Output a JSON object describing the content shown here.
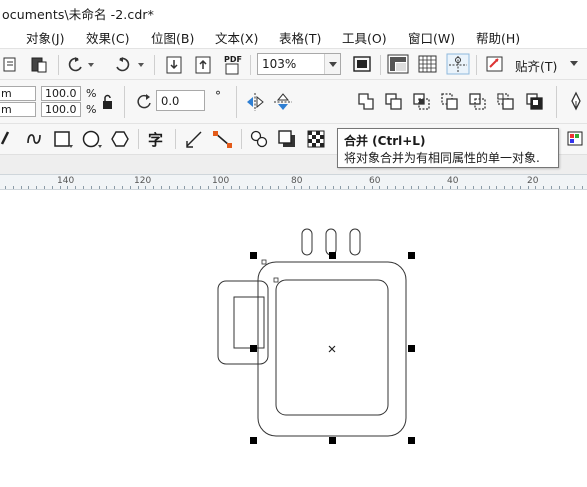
{
  "window": {
    "title": "ocuments\\未命名 -2.cdr*"
  },
  "menu": [
    {
      "label": "对象(J)"
    },
    {
      "label": "效果(C)"
    },
    {
      "label": "位图(B)"
    },
    {
      "label": "文本(X)"
    },
    {
      "label": "表格(T)"
    },
    {
      "label": "工具(O)"
    },
    {
      "label": "窗口(W)"
    },
    {
      "label": "帮助(H)"
    }
  ],
  "toolbar": {
    "zoom_value": "103%",
    "pdf_label": "PDF",
    "snap_label": "贴齐(T)"
  },
  "properties": {
    "size_w_unit": "m",
    "size_h_unit": "m",
    "scale_x": "100.0",
    "scale_y": "100.0",
    "percent_x": "%",
    "percent_y": "%",
    "rotation": "0.0",
    "rotation_unit": "°"
  },
  "tools": {
    "text_tool_glyph": "字"
  },
  "tooltip": {
    "title": "合并 (Ctrl+L)",
    "description": "将对象合并为有相同属性的单一对象."
  },
  "ruler": {
    "labels": [
      "140",
      "120",
      "100",
      "80",
      "60",
      "40",
      "20"
    ]
  },
  "colors": {
    "highlight": "#e0393e",
    "selected_button": "#cfe8fb",
    "ruler_bg": "#f1f4f6"
  }
}
